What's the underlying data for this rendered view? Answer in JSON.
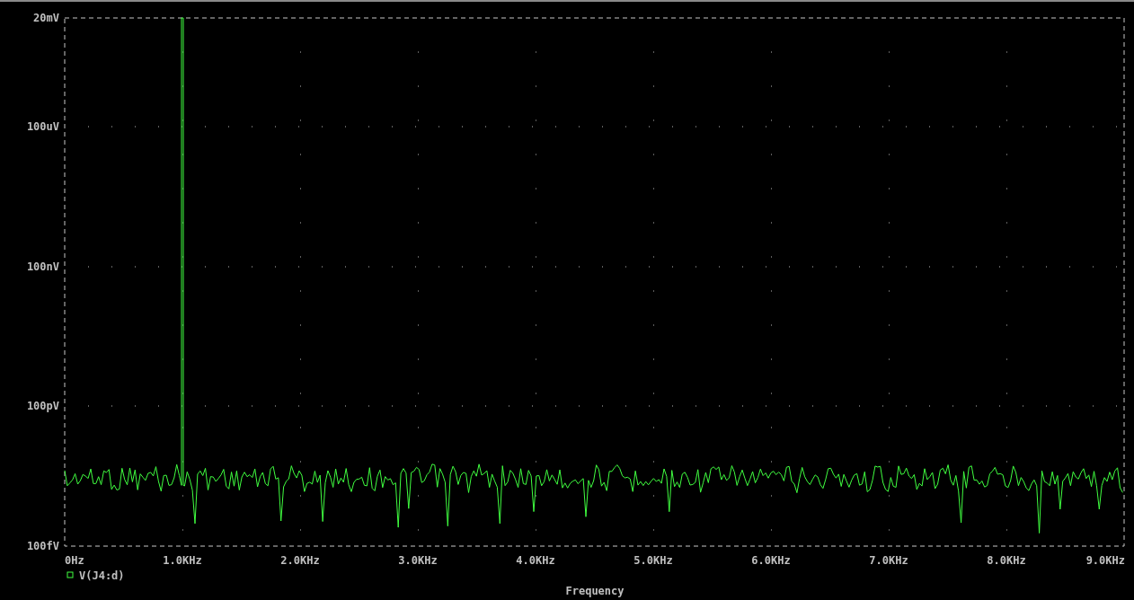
{
  "plot": {
    "y_ticks": [
      "20mV",
      "100uV",
      "100nV",
      "100pV",
      "100fV"
    ],
    "x_ticks": [
      "0Hz",
      "1.0KHz",
      "2.0KHz",
      "3.0KHz",
      "4.0KHz",
      "5.0KHz",
      "6.0KHz",
      "7.0KHz",
      "8.0KHz",
      "9.0KHz"
    ],
    "xlabel": "Frequency",
    "legend": [
      {
        "label": "V(J4:d)",
        "color": "#40ff40"
      }
    ]
  }
}
